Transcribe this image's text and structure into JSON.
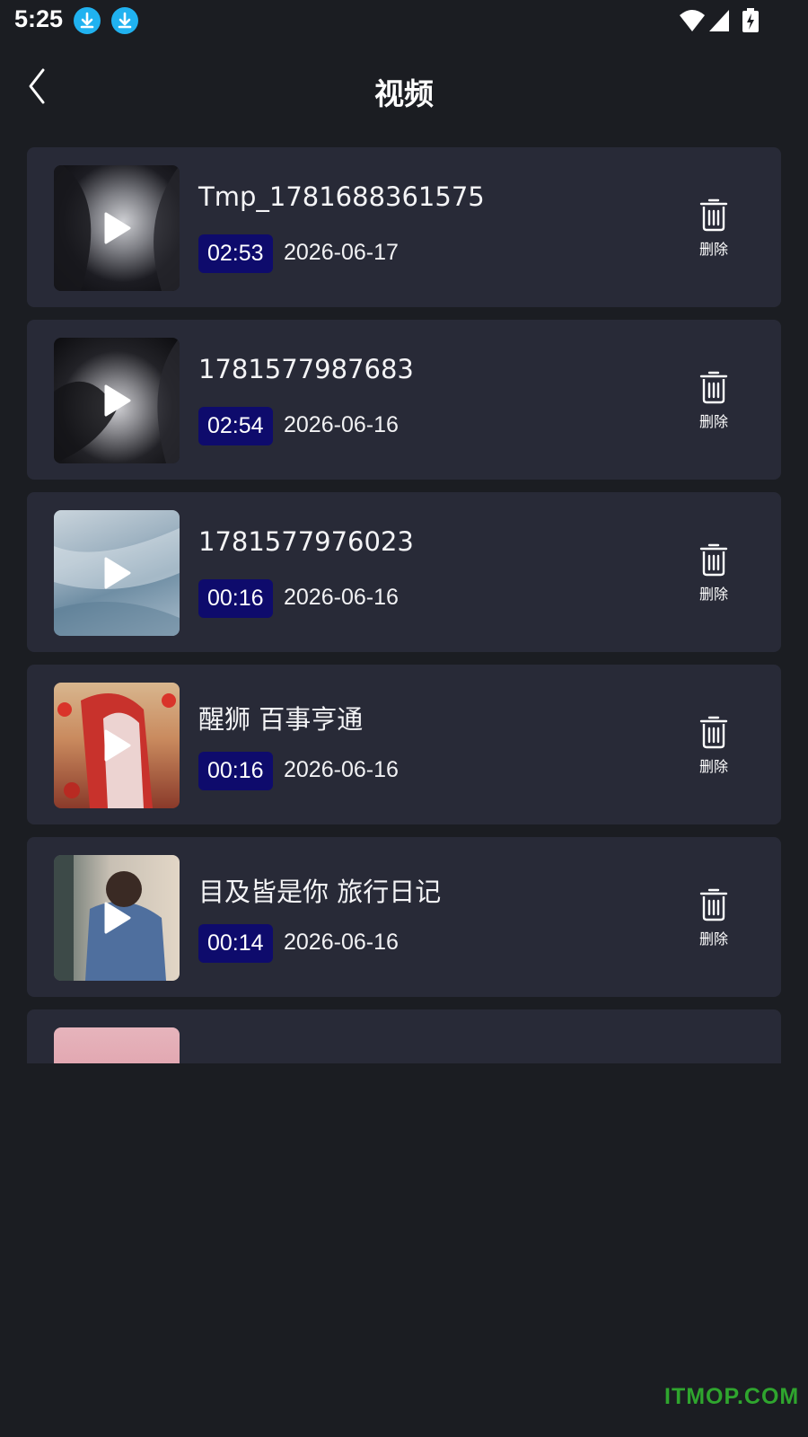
{
  "status_bar": {
    "time": "5:25",
    "icons": [
      "download-icon",
      "download-icon",
      "wifi-icon",
      "signal-icon",
      "battery-charging-icon"
    ]
  },
  "header": {
    "title": "视频",
    "back_icon": "chevron-left-icon"
  },
  "videos": [
    {
      "title": "Tmp_1781688361575",
      "duration": "02:53",
      "date": "2026-06-17",
      "delete_label": "删除"
    },
    {
      "title": "1781577987683",
      "duration": "02:54",
      "date": "2026-06-16",
      "delete_label": "删除"
    },
    {
      "title": "1781577976023",
      "duration": "00:16",
      "date": "2026-06-16",
      "delete_label": "删除"
    },
    {
      "title": "醒狮 百事亨通",
      "duration": "00:16",
      "date": "2026-06-16",
      "delete_label": "删除"
    },
    {
      "title": "目及皆是你 旅行日记",
      "duration": "00:14",
      "date": "2026-06-16",
      "delete_label": "删除"
    }
  ],
  "watermark": "ITMOP.COM",
  "colors": {
    "background": "#1b1d22",
    "card": "#282a37",
    "duration_badge": "#0e0b6c",
    "download_icon": "#20b2f0",
    "watermark": "#2fa52e"
  }
}
